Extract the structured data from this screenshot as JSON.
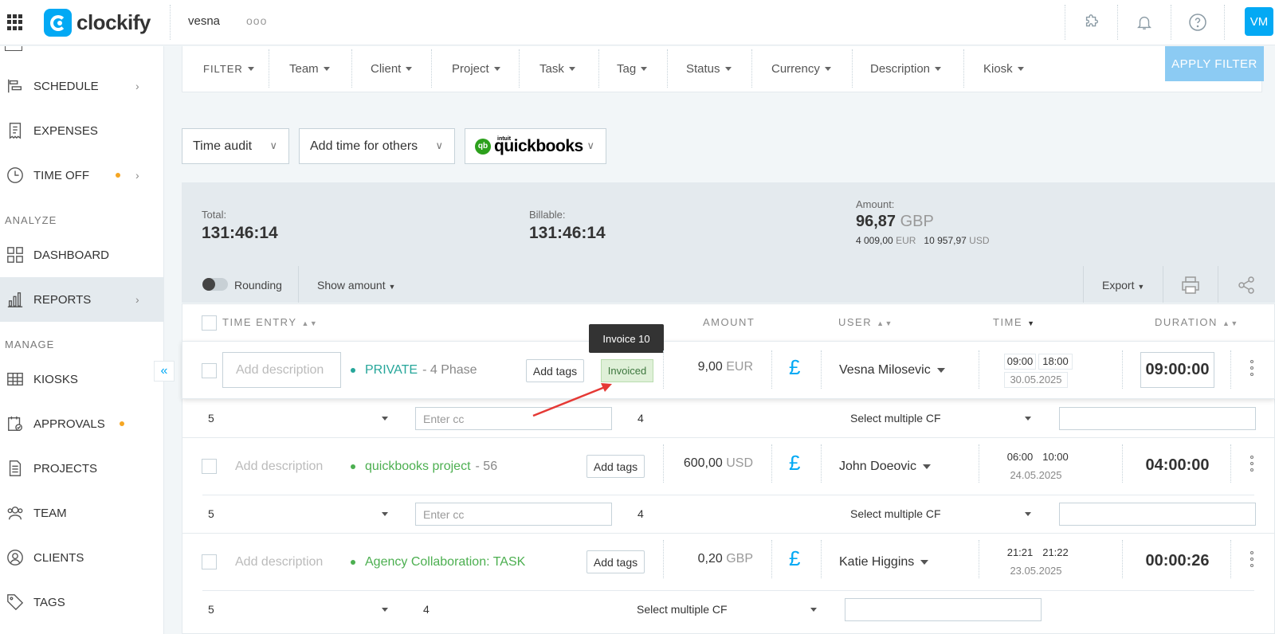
{
  "header": {
    "workspace": "vesna",
    "brand": "clockify",
    "more": "ooo",
    "avatar_initials": "VM"
  },
  "sidebar": {
    "items": [
      {
        "label": "SCHEDULE"
      },
      {
        "label": "EXPENSES"
      },
      {
        "label": "TIME OFF"
      },
      {
        "label": "DASHBOARD"
      },
      {
        "label": "REPORTS"
      },
      {
        "label": "KIOSKS"
      },
      {
        "label": "APPROVALS"
      },
      {
        "label": "PROJECTS"
      },
      {
        "label": "TEAM"
      },
      {
        "label": "CLIENTS"
      },
      {
        "label": "TAGS"
      }
    ],
    "sections": {
      "analyze": "ANALYZE",
      "manage": "MANAGE"
    }
  },
  "filters": {
    "items": [
      "FILTER",
      "Team",
      "Client",
      "Project",
      "Task",
      "Tag",
      "Status",
      "Currency",
      "Description",
      "Kiosk"
    ],
    "apply": "APPLY FILTER"
  },
  "dropdowns": {
    "audit": "Time audit",
    "add_time": "Add time for others",
    "qb_word": "quickbooks",
    "qb_intuit": "intuit",
    "qb_mark": "qb"
  },
  "summary": {
    "total_label": "Total:",
    "total": "131:46:14",
    "billable_label": "Billable:",
    "billable": "131:46:14",
    "amount_label": "Amount:",
    "amount": "96,87",
    "amount_cur": "GBP",
    "eur": "4 009,00",
    "eur_cur": "EUR",
    "usd": "10 957,97",
    "usd_cur": "USD"
  },
  "controls": {
    "rounding": "Rounding",
    "show_amount": "Show amount",
    "export": "Export"
  },
  "table_headers": {
    "entry": "TIME ENTRY",
    "amount": "AMOUNT",
    "user": "USER",
    "time": "TIME",
    "duration": "DURATION"
  },
  "tooltip": "Invoice 10",
  "rows": [
    {
      "desc": "Add description",
      "project": "PRIVATE",
      "sub": "- 4 Phase",
      "tags": "Add tags",
      "badge": "Invoiced",
      "amount": "9,00",
      "cur": "EUR",
      "pound": "£",
      "user": "Vesna Milosevic",
      "start": "09:00",
      "end": "18:00",
      "date": "30.05.2025",
      "duration": "09:00:00",
      "cf": {
        "num": "5",
        "cc": "Enter cc",
        "val": "4",
        "multi": "Select multiple CF"
      }
    },
    {
      "desc": "Add description",
      "project": "quickbooks project",
      "sub": "- 56",
      "tags": "Add tags",
      "amount": "600,00",
      "cur": "USD",
      "pound": "£",
      "user": "John Doeovic",
      "start": "06:00",
      "end": "10:00",
      "date": "24.05.2025",
      "duration": "04:00:00",
      "cf": {
        "num": "5",
        "cc": "Enter cc",
        "val": "4",
        "multi": "Select multiple CF"
      }
    },
    {
      "desc": "Add description",
      "project": "Agency Collaboration: TASK",
      "tags": "Add tags",
      "amount": "0,20",
      "cur": "GBP",
      "pound": "£",
      "user": "Katie Higgins",
      "start": "21:21",
      "end": "21:22",
      "date": "23.05.2025",
      "duration": "00:00:26",
      "cf": {
        "num": "5",
        "val": "4",
        "multi": "Select multiple CF"
      }
    }
  ],
  "colors": {
    "accent": "#03a9f4",
    "private": "#26a69a",
    "project_green": "#4caf50",
    "arrow": "#e53935"
  }
}
